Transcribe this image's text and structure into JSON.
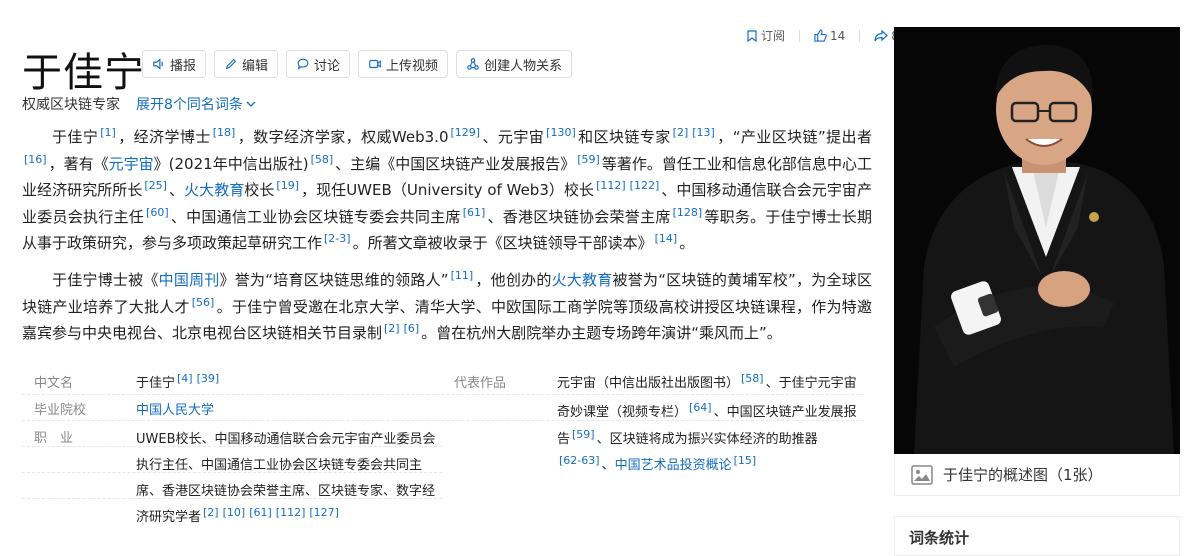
{
  "header": {
    "title": "于佳宁",
    "buttons": [
      {
        "label": "播报",
        "icon": "speaker-icon"
      },
      {
        "label": "编辑",
        "icon": "pencil-icon"
      },
      {
        "label": "讨论",
        "icon": "chat-bubble-icon"
      },
      {
        "label": "上传视频",
        "icon": "video-upload-icon"
      },
      {
        "label": "创建人物关系",
        "icon": "relation-icon"
      }
    ],
    "actions": {
      "subscribe": "订阅",
      "likes": "14",
      "shares": "8"
    },
    "subtitle": "权威区块链专家",
    "expand_label": "展开8个同名词条"
  },
  "paragraph1": {
    "t1": "于佳宁",
    "r1": "[1]",
    "t2": "，经济学博士",
    "r2": "[18]",
    "t3": "，数字经济学家，权威Web3.0",
    "r3": "[129]",
    "t4": "、元宇宙",
    "r4": "[130]",
    "t5": "和区块链专家",
    "r5": "[2]",
    "r6": "[13]",
    "t6": "，“产业区块链”提出者",
    "r7": "[16]",
    "t7": "，著有《",
    "link1": "元宇宙",
    "t8": "》(2021年中信出版社)",
    "r8": "[58]",
    "t9": "、主编《中国区块链产业发展报告》",
    "r9": "[59]",
    "t10": "等著作。曾任工业和信息化部信息中心工业经济研究所所长",
    "r10": "[25]",
    "t11": "、",
    "link2": "火大教育",
    "t12": "校长",
    "r11": "[19]",
    "t13": "，现任UWEB（University of Web3）校长",
    "r12": "[112]",
    "r13": "[122]",
    "t14": "、中国移动通信联合会元宇宙产业委员会执行主任",
    "r14": "[60]",
    "t15": "、中国通信工业协会区块链专委会共同主席",
    "r15": "[61]",
    "t16": "、香港区块链协会荣誉主席",
    "r16": "[128]",
    "t17": "等职务。于佳宁博士长期从事于政策研究，参与多项政策起草研究工作",
    "r17": "[2-3]",
    "t18": "。所著文章被收录于《区块链领导干部读本》",
    "r18": "[14]",
    "t19": "。"
  },
  "paragraph2": {
    "t1": "于佳宁博士被《",
    "link1": "中国周刊",
    "t2": "》誉为“培育区块链思维的领路人”",
    "r1": "[11]",
    "t3": "，他创办的",
    "link2": "火大教育",
    "t4": "被誉为“区块链的黄埔军校”，为全球区块链产业培养了大批人才",
    "r2": "[56]",
    "t5": "。于佳宁曾受邀在北京大学、清华大学、中欧国际工商学院等顶级高校讲授区块链课程，作为特邀嘉宾参与中央电视台、北京电视台区块链相关节目录制",
    "r3": "[2]",
    "r4": "[6]",
    "t6": "。曾在杭州大剧院举办主题专场跨年演讲“乘风而上”。"
  },
  "info": {
    "chinese_name_label": "中文名",
    "chinese_name": "于佳宁",
    "chinese_name_refs": [
      "[4]",
      "[39]"
    ],
    "school_label": "毕业院校",
    "school": "中国人民大学",
    "job_label": "职　业",
    "job_lines": [
      "UWEB校长、中国移动通信联合会元宇宙产业委员会",
      "执行主任、中国通信工业协会区块链专委会共同主",
      "席、香港区块链协会荣誉主席、区块链专家、数字经",
      "济研究学者"
    ],
    "job_refs": [
      "[2]",
      "[10]",
      "[61]",
      "[112]",
      "[127]"
    ],
    "works_label": "代表作品",
    "works_line1": "元宇宙（中信出版社出版图书）",
    "works_ref1": "[58]",
    "works_line1b": "、于佳宁元宇宙",
    "works_line2": "奇妙课堂（视频专栏）",
    "works_ref2": "[64]",
    "works_line2b": "、中国区块链产业发展报",
    "works_line3": "告",
    "works_ref3": "[59]",
    "works_line3b": "、区块链将成为振兴实体经济的助推器",
    "works_ref4": "[62-63]",
    "works_line4": "、",
    "works_link4": "中国艺术品投资概论",
    "works_ref5": "[15]"
  },
  "sidebar": {
    "caption": "于佳宁的概述图（1张）",
    "card_title": "词条统计"
  }
}
